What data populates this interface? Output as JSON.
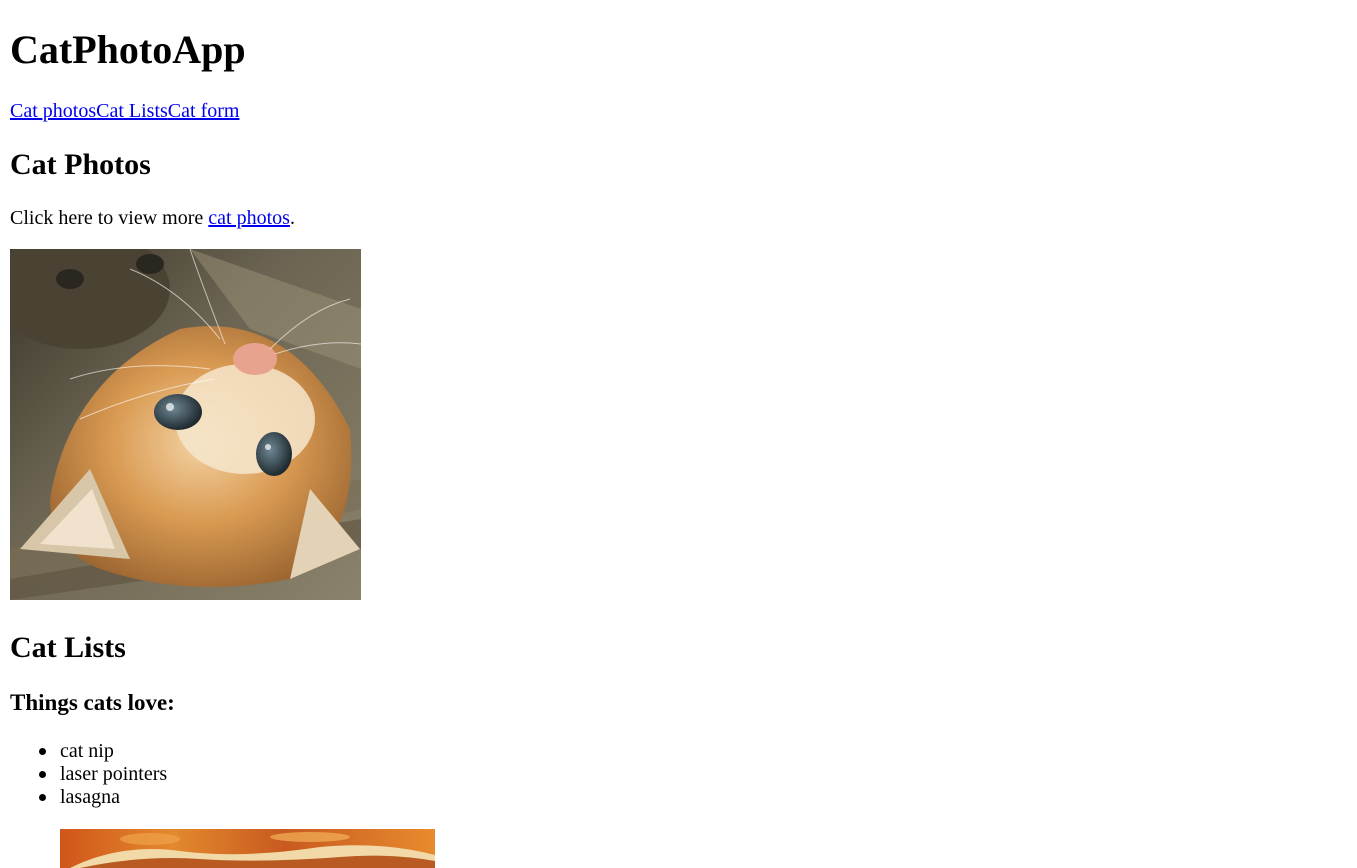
{
  "app": {
    "title": "CatPhotoApp"
  },
  "nav": {
    "links": [
      {
        "label": "Cat photos"
      },
      {
        "label": "Cat Lists"
      },
      {
        "label": "Cat form"
      }
    ]
  },
  "photos_section": {
    "heading": "Cat Photos",
    "text_before": "Click here to view more ",
    "link_label": "cat photos",
    "text_after": ".",
    "image_icon": "cat-photo"
  },
  "lists_section": {
    "heading": "Cat Lists",
    "subheading": "Things cats love:",
    "items": [
      {
        "label": "cat nip"
      },
      {
        "label": "laser pointers"
      },
      {
        "label": "lasagna"
      }
    ],
    "image_icon": "lasagna-photo"
  },
  "colors": {
    "link": "#0000ee",
    "text": "#000000",
    "background": "#ffffff"
  }
}
